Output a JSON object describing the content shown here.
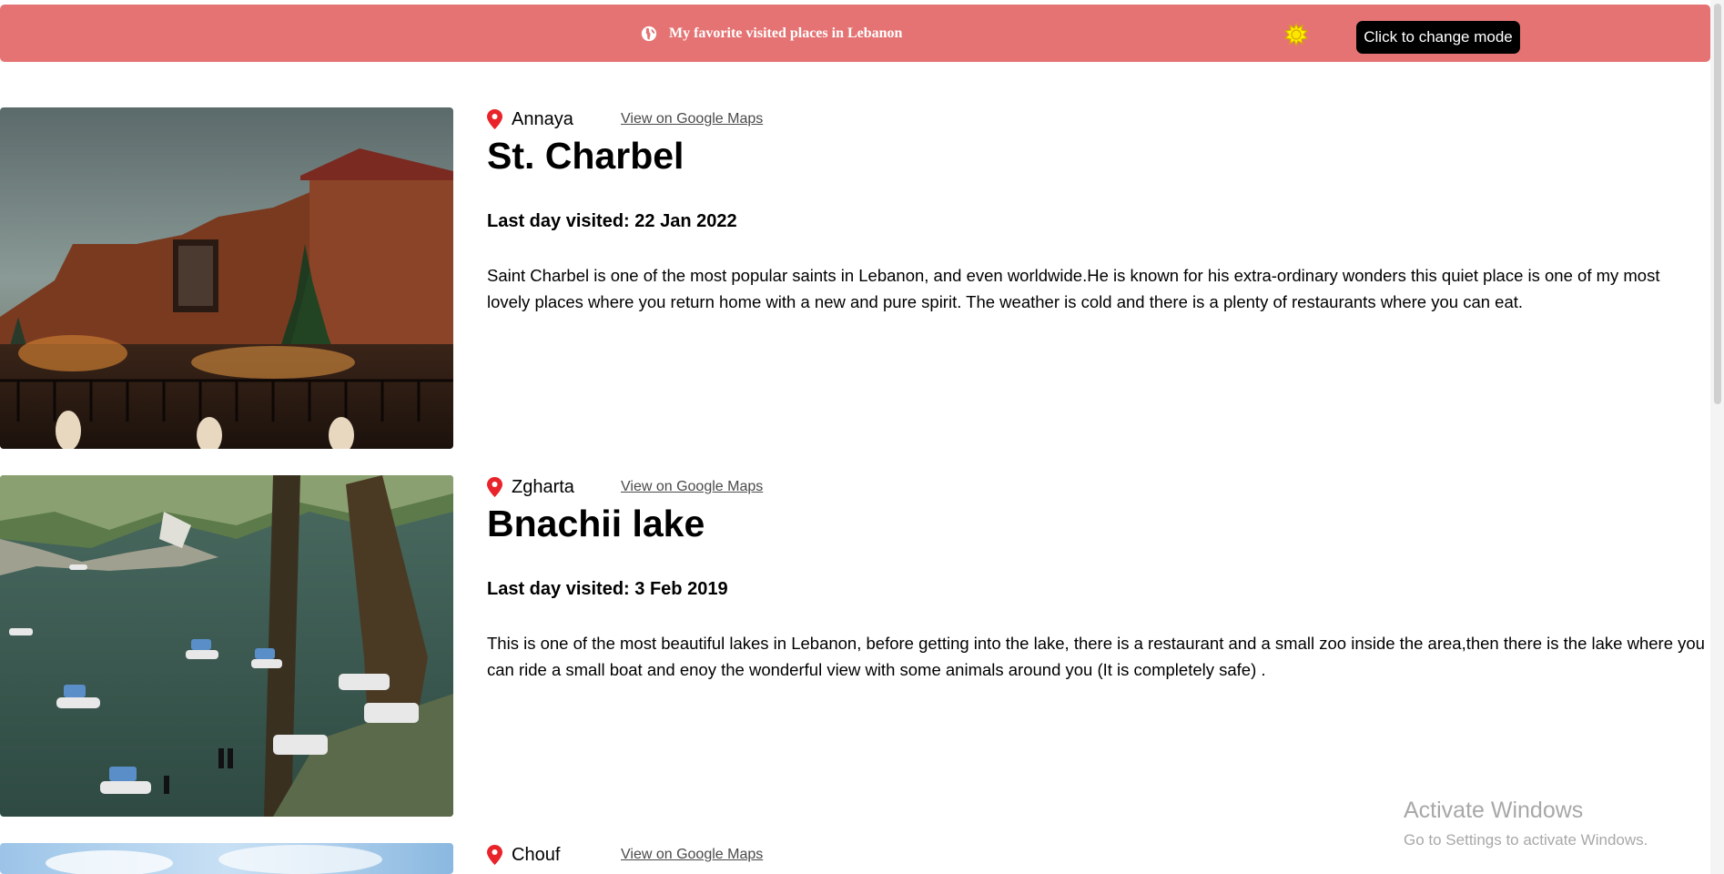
{
  "header": {
    "title": "My favorite visited places in Lebanon",
    "globe_icon": "globe-icon",
    "sun_icon": "sun-icon",
    "mode_button_label": "Click to change mode",
    "background_color": "#e57373",
    "sun_color": "#ffee00"
  },
  "places": [
    {
      "location": "Annaya",
      "maps_link_label": "View on Google Maps",
      "title": "St. Charbel",
      "visited": "Last day visited: 22 Jan 2022",
      "description": "Saint Charbel is one of the most popular saints in Lebanon, and even worldwide.He is known for his extra-ordinary wonders this quiet place is one of my most lovely places where you return home with a new and pure spirit. The weather is cold and there is a plenty of restaurants where you can eat."
    },
    {
      "location": "Zgharta",
      "maps_link_label": "View on Google Maps",
      "title": "Bnachii lake",
      "visited": "Last day visited: 3 Feb 2019",
      "description": "This is one of the most beautiful lakes in Lebanon, before getting into the lake, there is a restaurant and a small zoo inside the area,then there is the lake where you can ride a small boat and enoy the wonderful view with some animals around you (It is completely safe) ."
    },
    {
      "location": "Chouf",
      "maps_link_label": "View on Google Maps"
    }
  ],
  "watermark": {
    "title": "Activate Windows",
    "subtitle": "Go to Settings to activate Windows."
  },
  "colors": {
    "pin": "#e8242a",
    "link": "#4a4a4a"
  }
}
